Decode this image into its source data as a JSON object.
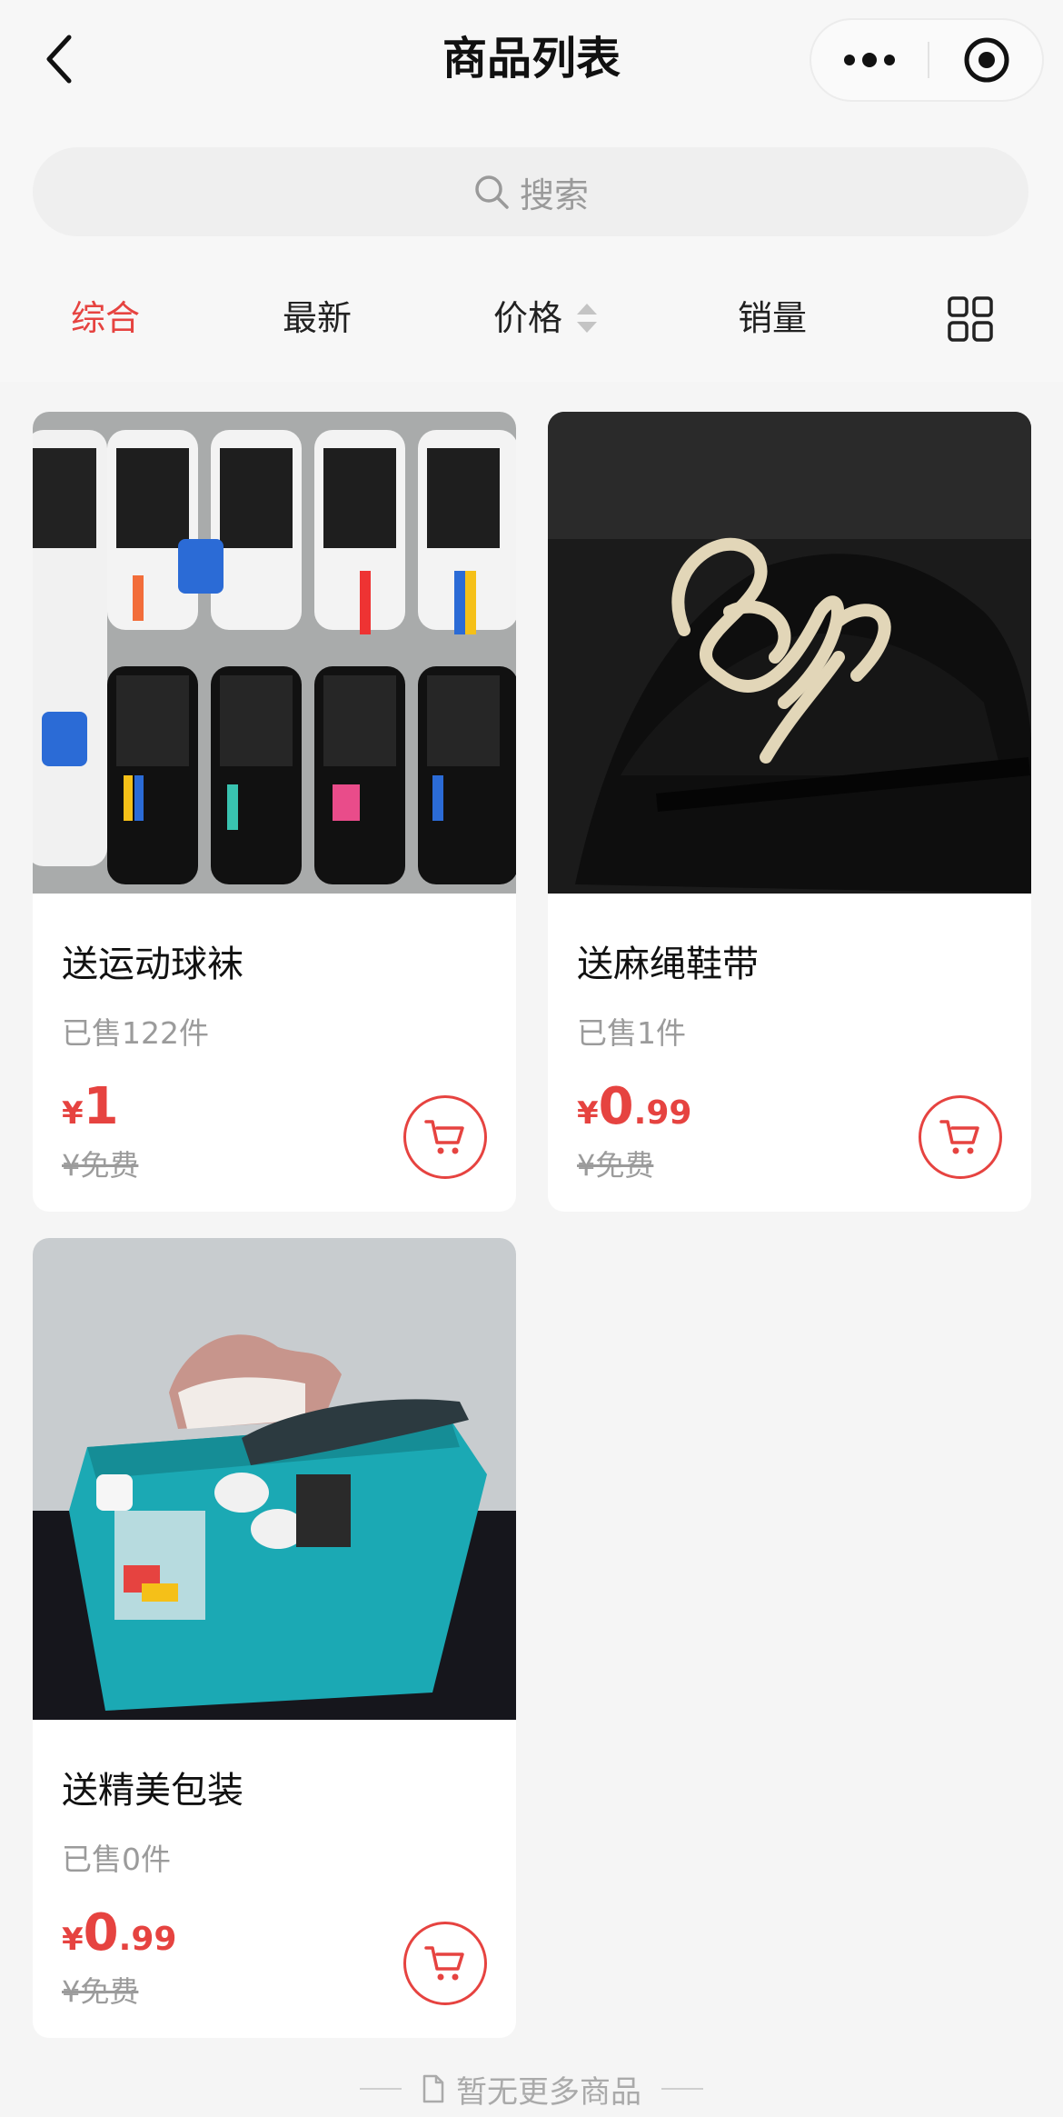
{
  "nav": {
    "title": "商品列表"
  },
  "search": {
    "placeholder": "搜索"
  },
  "sort": {
    "tabs": [
      {
        "label": "综合",
        "active": true
      },
      {
        "label": "最新",
        "active": false
      },
      {
        "label": "价格",
        "active": false
      },
      {
        "label": "销量",
        "active": false
      }
    ]
  },
  "products": [
    {
      "name": "送运动球袜",
      "sold": "已售122件",
      "price_symbol": "¥",
      "price_int": "1",
      "price_dec": "",
      "original": "¥免费"
    },
    {
      "name": "送麻绳鞋带",
      "sold": "已售1件",
      "price_symbol": "¥",
      "price_int": "0",
      "price_dec": ".99",
      "original": "¥免费"
    },
    {
      "name": "送精美包装",
      "sold": "已售0件",
      "price_symbol": "¥",
      "price_int": "0",
      "price_dec": ".99",
      "original": "¥免费"
    }
  ],
  "footer": {
    "text": "暂无更多商品"
  },
  "colors": {
    "accent": "#e64340",
    "background": "#f5f5f5"
  }
}
